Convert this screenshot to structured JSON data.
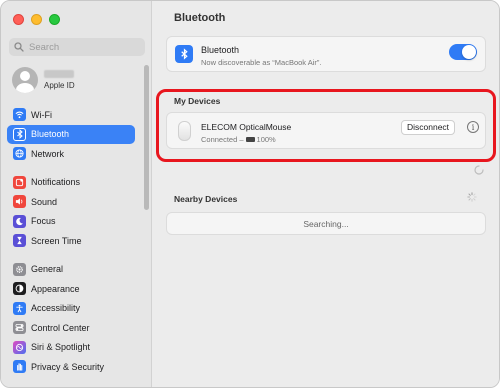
{
  "sidebar": {
    "search_placeholder": "Search",
    "account_sub": "Apple ID",
    "items": [
      {
        "label": "Wi-Fi",
        "icon": "wifi-icon",
        "color": "#2f7bf5"
      },
      {
        "label": "Bluetooth",
        "icon": "bluetooth-icon",
        "color": "#2f7bf5",
        "active": true
      },
      {
        "label": "Network",
        "icon": "globe-icon",
        "color": "#2f7bf5"
      },
      {
        "label": "Notifications",
        "icon": "bell-icon",
        "color": "#f0463c"
      },
      {
        "label": "Sound",
        "icon": "speaker-icon",
        "color": "#f0463c"
      },
      {
        "label": "Focus",
        "icon": "moon-icon",
        "color": "#5a4fd6"
      },
      {
        "label": "Screen Time",
        "icon": "hourglass-icon",
        "color": "#5a4fd6"
      },
      {
        "label": "General",
        "icon": "gear-icon",
        "color": "#8e8e93"
      },
      {
        "label": "Appearance",
        "icon": "appearance-icon",
        "color": "#1d1d1f"
      },
      {
        "label": "Accessibility",
        "icon": "accessibility-icon",
        "color": "#2f7bf5"
      },
      {
        "label": "Control Center",
        "icon": "control-center-icon",
        "color": "#8e8e93"
      },
      {
        "label": "Siri & Spotlight",
        "icon": "siri-icon",
        "color": "#b15de0"
      },
      {
        "label": "Privacy & Security",
        "icon": "hand-icon",
        "color": "#2f7bf5"
      }
    ]
  },
  "main": {
    "title": "Bluetooth",
    "bluetooth": {
      "label": "Bluetooth",
      "subtitle": "Now discoverable as “MacBook Air”.",
      "enabled": true
    },
    "my_devices_title": "My Devices",
    "device": {
      "name": "ELECOM OpticalMouse",
      "status": "Connected –",
      "battery": "100%",
      "disconnect_label": "Disconnect",
      "info_label": "i"
    },
    "nearby_title": "Nearby Devices",
    "searching_label": "Searching..."
  },
  "colors": {
    "accent": "#2f7bf5",
    "highlight": "#e8161e"
  }
}
